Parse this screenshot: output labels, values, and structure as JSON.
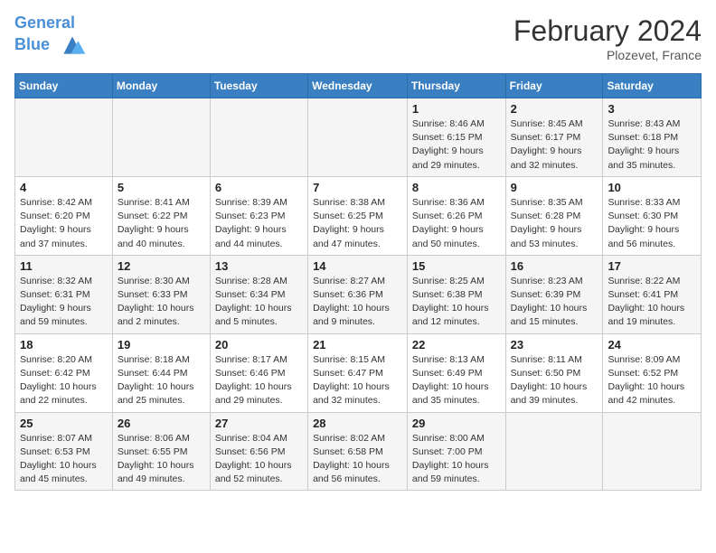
{
  "header": {
    "logo_line1": "General",
    "logo_line2": "Blue",
    "month_title": "February 2024",
    "location": "Plozevet, France"
  },
  "days_of_week": [
    "Sunday",
    "Monday",
    "Tuesday",
    "Wednesday",
    "Thursday",
    "Friday",
    "Saturday"
  ],
  "weeks": [
    [
      {
        "day": "",
        "info": ""
      },
      {
        "day": "",
        "info": ""
      },
      {
        "day": "",
        "info": ""
      },
      {
        "day": "",
        "info": ""
      },
      {
        "day": "1",
        "info": "Sunrise: 8:46 AM\nSunset: 6:15 PM\nDaylight: 9 hours and 29 minutes."
      },
      {
        "day": "2",
        "info": "Sunrise: 8:45 AM\nSunset: 6:17 PM\nDaylight: 9 hours and 32 minutes."
      },
      {
        "day": "3",
        "info": "Sunrise: 8:43 AM\nSunset: 6:18 PM\nDaylight: 9 hours and 35 minutes."
      }
    ],
    [
      {
        "day": "4",
        "info": "Sunrise: 8:42 AM\nSunset: 6:20 PM\nDaylight: 9 hours and 37 minutes."
      },
      {
        "day": "5",
        "info": "Sunrise: 8:41 AM\nSunset: 6:22 PM\nDaylight: 9 hours and 40 minutes."
      },
      {
        "day": "6",
        "info": "Sunrise: 8:39 AM\nSunset: 6:23 PM\nDaylight: 9 hours and 44 minutes."
      },
      {
        "day": "7",
        "info": "Sunrise: 8:38 AM\nSunset: 6:25 PM\nDaylight: 9 hours and 47 minutes."
      },
      {
        "day": "8",
        "info": "Sunrise: 8:36 AM\nSunset: 6:26 PM\nDaylight: 9 hours and 50 minutes."
      },
      {
        "day": "9",
        "info": "Sunrise: 8:35 AM\nSunset: 6:28 PM\nDaylight: 9 hours and 53 minutes."
      },
      {
        "day": "10",
        "info": "Sunrise: 8:33 AM\nSunset: 6:30 PM\nDaylight: 9 hours and 56 minutes."
      }
    ],
    [
      {
        "day": "11",
        "info": "Sunrise: 8:32 AM\nSunset: 6:31 PM\nDaylight: 9 hours and 59 minutes."
      },
      {
        "day": "12",
        "info": "Sunrise: 8:30 AM\nSunset: 6:33 PM\nDaylight: 10 hours and 2 minutes."
      },
      {
        "day": "13",
        "info": "Sunrise: 8:28 AM\nSunset: 6:34 PM\nDaylight: 10 hours and 5 minutes."
      },
      {
        "day": "14",
        "info": "Sunrise: 8:27 AM\nSunset: 6:36 PM\nDaylight: 10 hours and 9 minutes."
      },
      {
        "day": "15",
        "info": "Sunrise: 8:25 AM\nSunset: 6:38 PM\nDaylight: 10 hours and 12 minutes."
      },
      {
        "day": "16",
        "info": "Sunrise: 8:23 AM\nSunset: 6:39 PM\nDaylight: 10 hours and 15 minutes."
      },
      {
        "day": "17",
        "info": "Sunrise: 8:22 AM\nSunset: 6:41 PM\nDaylight: 10 hours and 19 minutes."
      }
    ],
    [
      {
        "day": "18",
        "info": "Sunrise: 8:20 AM\nSunset: 6:42 PM\nDaylight: 10 hours and 22 minutes."
      },
      {
        "day": "19",
        "info": "Sunrise: 8:18 AM\nSunset: 6:44 PM\nDaylight: 10 hours and 25 minutes."
      },
      {
        "day": "20",
        "info": "Sunrise: 8:17 AM\nSunset: 6:46 PM\nDaylight: 10 hours and 29 minutes."
      },
      {
        "day": "21",
        "info": "Sunrise: 8:15 AM\nSunset: 6:47 PM\nDaylight: 10 hours and 32 minutes."
      },
      {
        "day": "22",
        "info": "Sunrise: 8:13 AM\nSunset: 6:49 PM\nDaylight: 10 hours and 35 minutes."
      },
      {
        "day": "23",
        "info": "Sunrise: 8:11 AM\nSunset: 6:50 PM\nDaylight: 10 hours and 39 minutes."
      },
      {
        "day": "24",
        "info": "Sunrise: 8:09 AM\nSunset: 6:52 PM\nDaylight: 10 hours and 42 minutes."
      }
    ],
    [
      {
        "day": "25",
        "info": "Sunrise: 8:07 AM\nSunset: 6:53 PM\nDaylight: 10 hours and 45 minutes."
      },
      {
        "day": "26",
        "info": "Sunrise: 8:06 AM\nSunset: 6:55 PM\nDaylight: 10 hours and 49 minutes."
      },
      {
        "day": "27",
        "info": "Sunrise: 8:04 AM\nSunset: 6:56 PM\nDaylight: 10 hours and 52 minutes."
      },
      {
        "day": "28",
        "info": "Sunrise: 8:02 AM\nSunset: 6:58 PM\nDaylight: 10 hours and 56 minutes."
      },
      {
        "day": "29",
        "info": "Sunrise: 8:00 AM\nSunset: 7:00 PM\nDaylight: 10 hours and 59 minutes."
      },
      {
        "day": "",
        "info": ""
      },
      {
        "day": "",
        "info": ""
      }
    ]
  ]
}
